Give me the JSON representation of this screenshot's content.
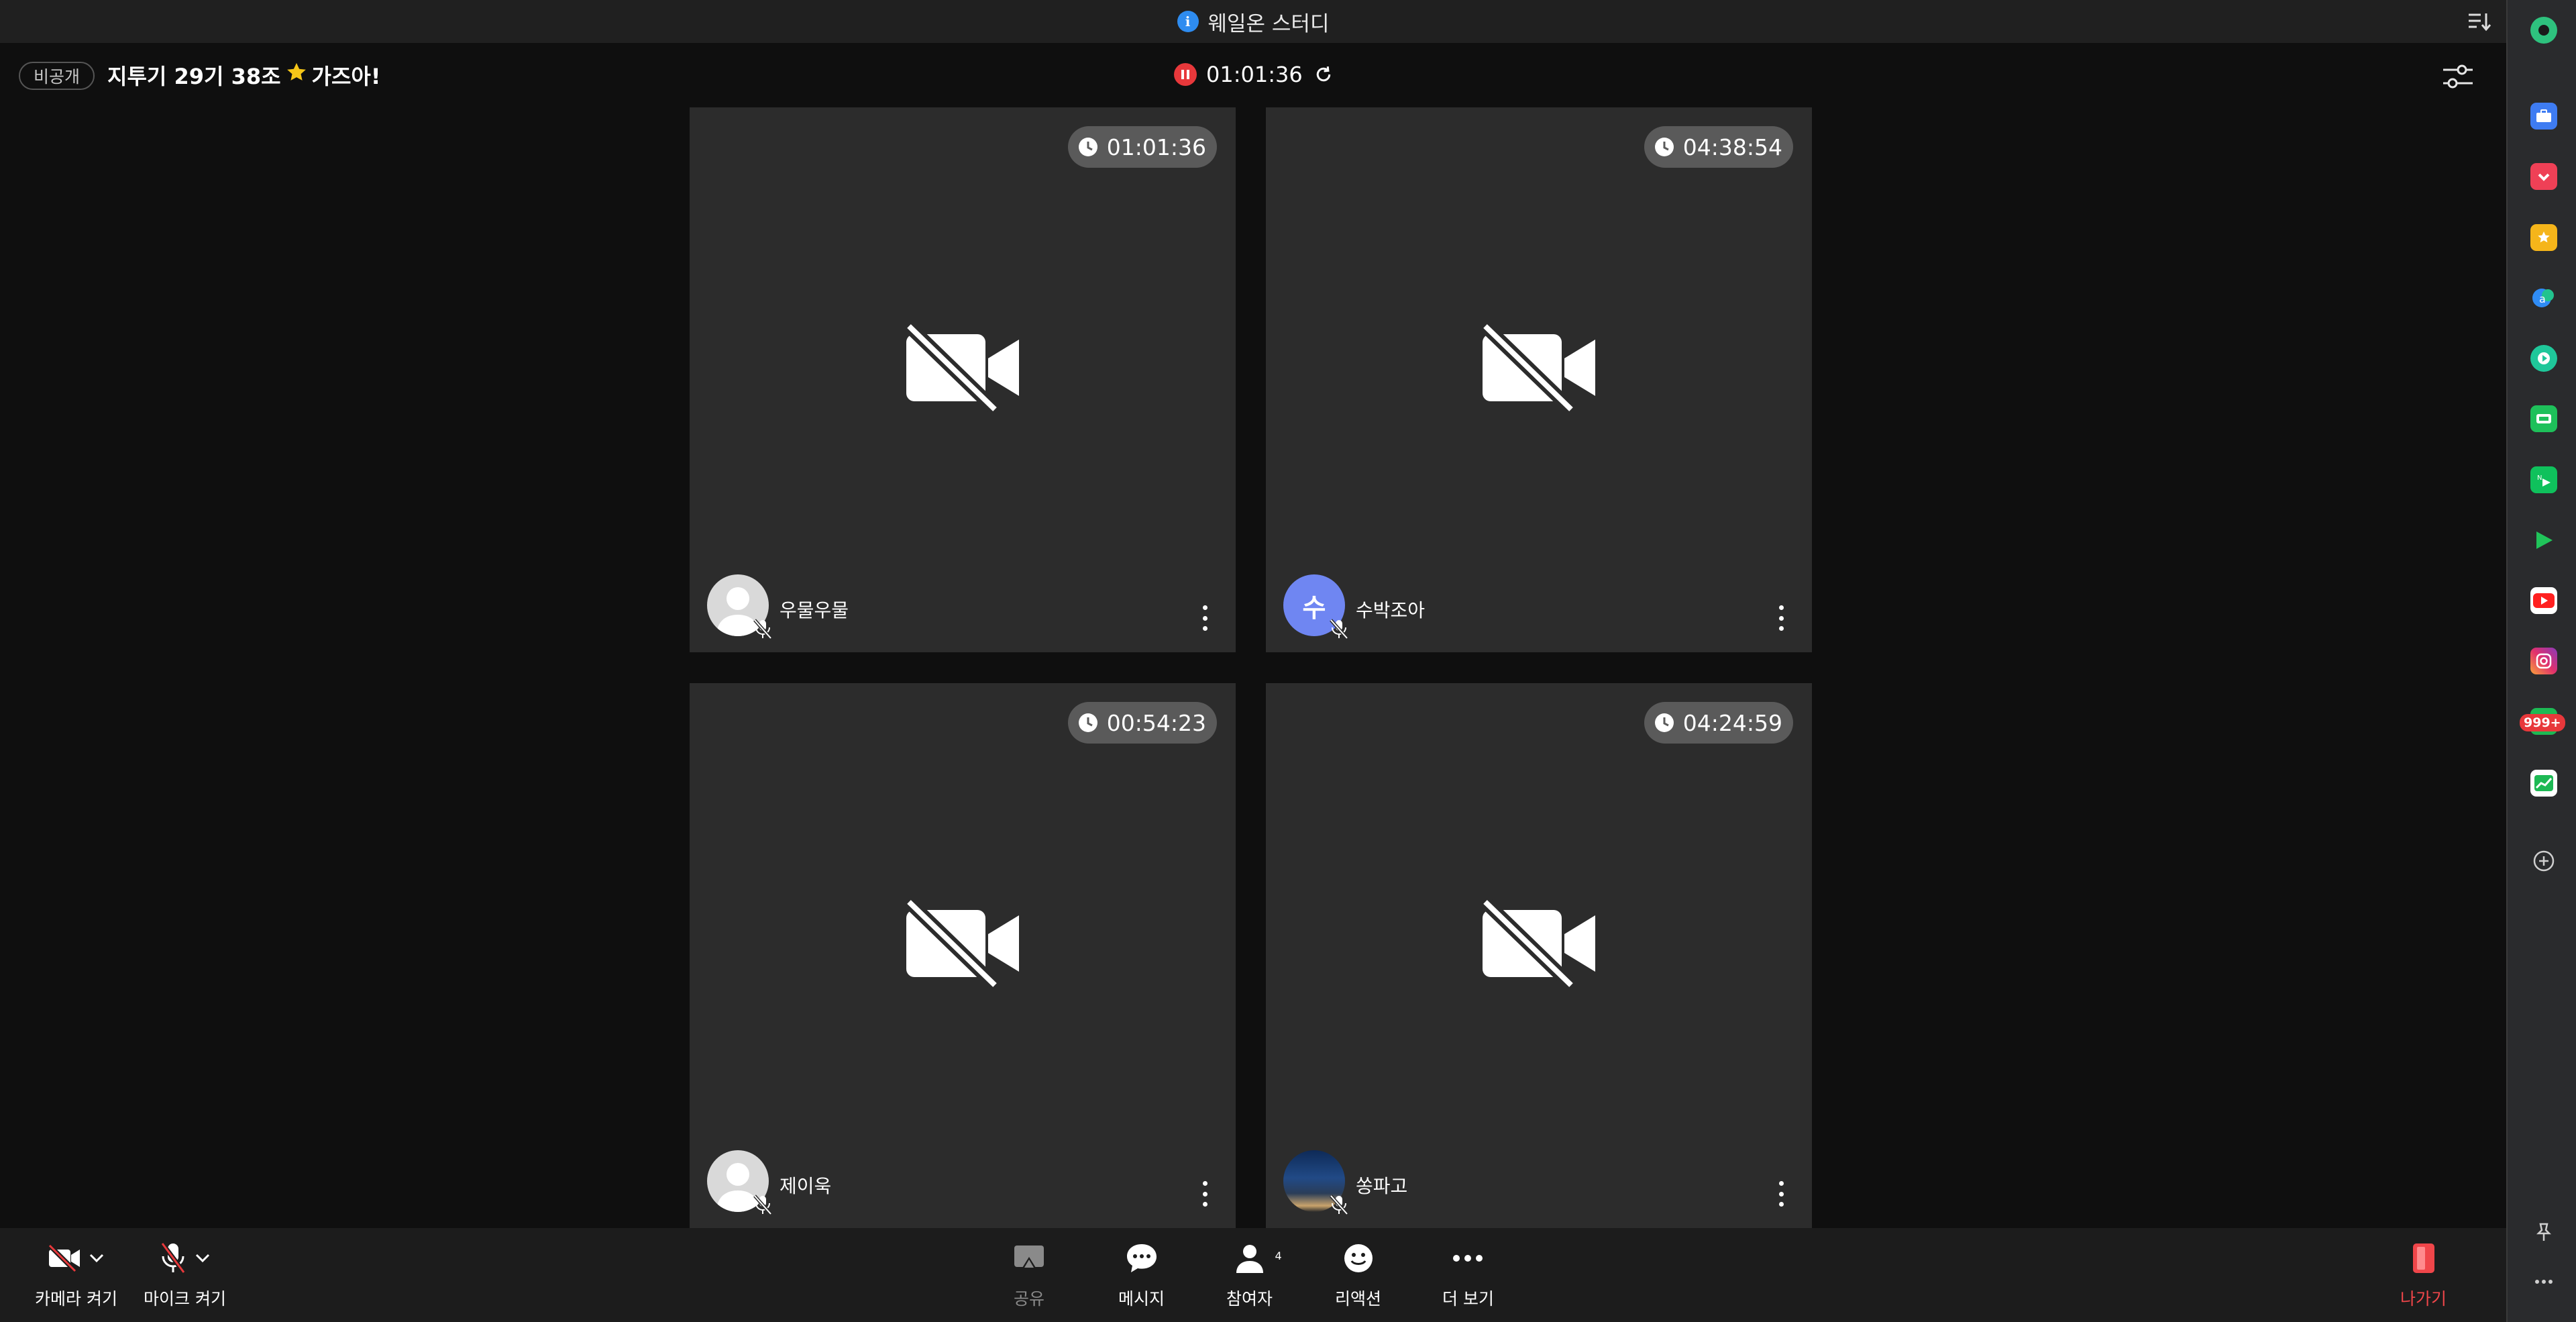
{
  "window": {
    "title": "웨일온 스터디"
  },
  "header": {
    "privacy_badge": "비공개",
    "room_name_pre": "지투기 29기 38조",
    "room_name_post": "가즈아!",
    "elapsed": "01:01:36"
  },
  "participants": [
    {
      "name": "우물우물",
      "time": "01:01:36",
      "avatar": "default"
    },
    {
      "name": "수박조아",
      "time": "04:38:54",
      "avatar": "initial",
      "initial": "수",
      "avatar_color": "#6f86f2"
    },
    {
      "name": "제이욱",
      "time": "00:54:23",
      "avatar": "default"
    },
    {
      "name": "쏭파고",
      "time": "04:24:59",
      "avatar": "photo"
    }
  ],
  "toolbar": {
    "camera_label": "카메라 켜기",
    "mic_label": "마이크 켜기",
    "share_label": "공유",
    "message_label": "메시지",
    "participants_label": "참여자",
    "participants_count": "4",
    "reaction_label": "리액션",
    "more_label": "더 보기",
    "leave_label": "나가기"
  },
  "sidebar": {
    "icons": [
      "whale-logo-icon",
      "briefcase-icon",
      "pocket-icon",
      "bookmark-star-icon",
      "translate-icon",
      "media-play-icon",
      "green-shopping-icon",
      "naver-tv-icon",
      "play-store-icon",
      "youtube-icon",
      "instagram-icon",
      "calendar-icon",
      "stock-chart-icon",
      "add-icon",
      "pin-icon",
      "more-icon"
    ],
    "calendar_badge": "999+"
  },
  "colors": {
    "accent_red": "#e8383b",
    "tile_bg": "#2c2c2c",
    "toolbar_bg": "#1c1c1c",
    "info_blue": "#2e8cf0"
  }
}
